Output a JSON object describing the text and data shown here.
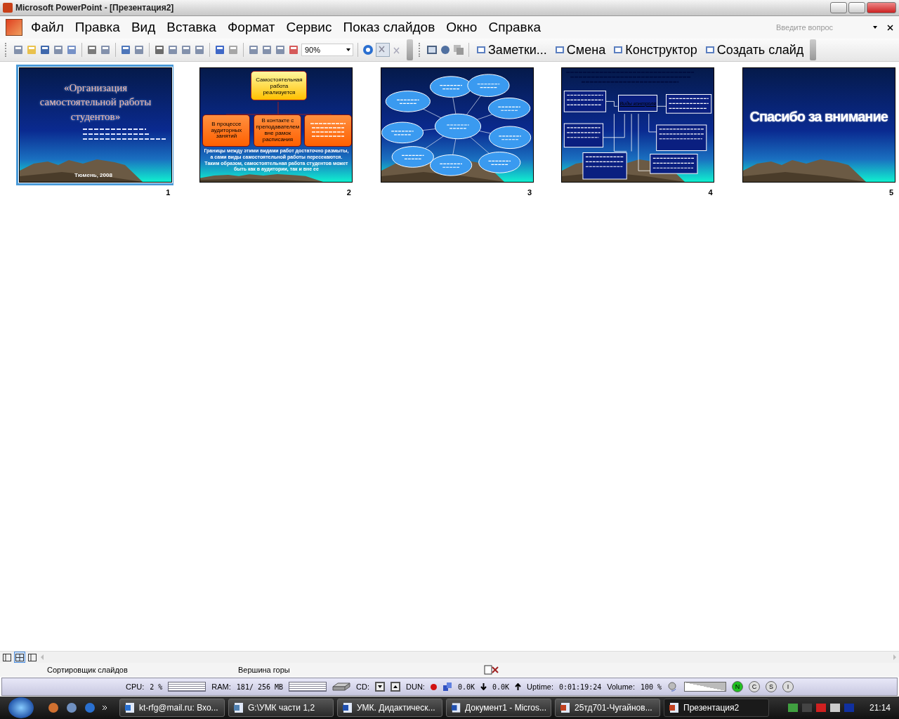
{
  "window": {
    "title": "Microsoft PowerPoint - [Презентация2]"
  },
  "menu": [
    {
      "label": "Файл"
    },
    {
      "label": "Правка"
    },
    {
      "label": "Вид"
    },
    {
      "label": "Вставка"
    },
    {
      "label": "Формат"
    },
    {
      "label": "Сервис"
    },
    {
      "label": "Показ слайдов"
    },
    {
      "label": "Окно"
    },
    {
      "label": "Справка"
    }
  ],
  "ask": {
    "placeholder": "Введите вопрос"
  },
  "toolbar": {
    "zoom": "90%",
    "buttons": [
      {
        "label": "Заметки..."
      },
      {
        "label": "Смена"
      },
      {
        "label": "Конструктор"
      },
      {
        "label": "Создать слайд"
      }
    ]
  },
  "slides": [
    {
      "number": "1",
      "selected": true,
      "kind": "title",
      "title": "«Организация самостоятельной работы студентов»",
      "footer": "Тюмень, 2008"
    },
    {
      "number": "2",
      "selected": false,
      "kind": "tree",
      "top": "Самостоятельная работа реализуется",
      "boxes": [
        "В процессе аудиторных занятий",
        "В контакте с преподавателем вне рамок расписания"
      ],
      "text": "Границы между этими видами работ достаточно размыты, а сами виды самостоятельной работы пересекаются. Таким образом, самостоятельная работа студентов может быть как в аудитории, так и вне ее"
    },
    {
      "number": "3",
      "selected": false,
      "kind": "cluster"
    },
    {
      "number": "4",
      "selected": false,
      "kind": "diagram",
      "center": "Виды контроля"
    },
    {
      "number": "5",
      "selected": false,
      "kind": "thanks",
      "title": "Спасибо за внимание"
    }
  ],
  "views": [
    {
      "selected": false
    },
    {
      "selected": true
    },
    {
      "selected": false
    }
  ],
  "status_bar": [
    "Сортировщик слайдов",
    "Вершина горы"
  ],
  "monitor": {
    "cpu_label": "CPU:",
    "cpu": "2 %",
    "ram_label": "RAM:",
    "ram": "181/ 256 MB",
    "cd_label": "CD:",
    "dun_label": "DUN:",
    "down": "0.0K",
    "up": "0.0K",
    "uptime_label": "Uptime:",
    "uptime": "0:01:19:24",
    "volume_label": "Volume:",
    "volume": "100 %",
    "volume_level": {
      "level": 1
    },
    "modes": [
      {
        "label": "N",
        "on": true
      },
      {
        "label": "C",
        "on": false
      },
      {
        "label": "S",
        "on": false
      },
      {
        "label": "I",
        "on": false
      }
    ]
  },
  "taskbar": {
    "tasks": [
      {
        "label": "kt-rfg@mail.ru: Вхо...",
        "selected": false
      },
      {
        "label": "G:\\УМК части 1,2",
        "selected": false
      },
      {
        "label": "УМК. Дидактическ...",
        "selected": false
      },
      {
        "label": "Документ1 - Micros...",
        "selected": false
      },
      {
        "label": "25тд701-Чугайнов...",
        "selected": false
      },
      {
        "label": "Презентация2",
        "selected": true
      }
    ],
    "clock": "21:14"
  }
}
